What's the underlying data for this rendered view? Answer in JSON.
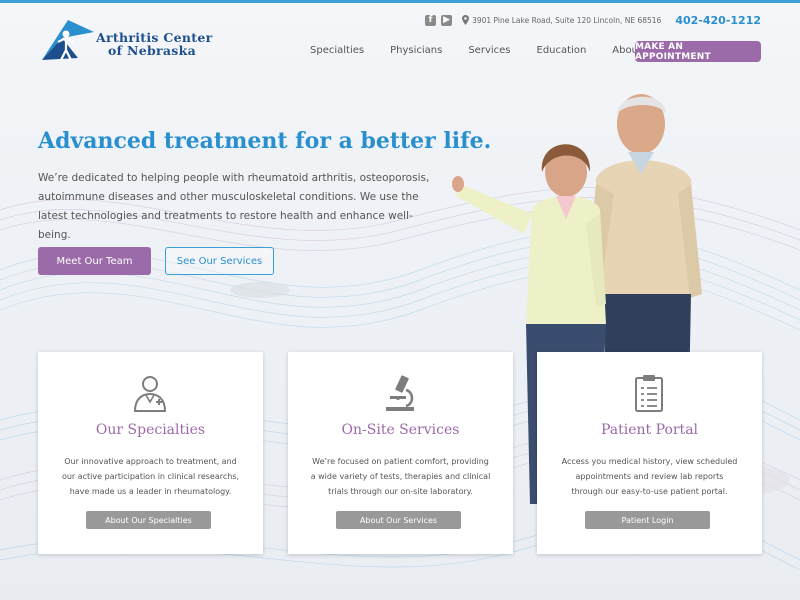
{
  "header": {
    "logo_line1": "Arthritis Center",
    "logo_line2": "of Nebraska",
    "facebook_icon": "facebook-icon",
    "youtube_icon": "youtube-icon",
    "address": "3901 Pine Lake Road, Suite 120 Lincoln, NE 68516",
    "phone": "402-420-1212",
    "nav": [
      "Specialties",
      "Physicians",
      "Services",
      "Education",
      "About"
    ],
    "cta_label": "MAKE AN APPOINTMENT"
  },
  "hero": {
    "headline": "Advanced treatment for a better life.",
    "intro": "We’re dedicated to helping people with rheumatoid arthritis, osteoporosis, autoimmune diseases and other musculoskeletal conditions. We use the latest technologies and treatments to restore health and enhance well-being.",
    "btn_team": "Meet Our Team",
    "btn_services": "See Our Services"
  },
  "cards": [
    {
      "icon": "doctor-icon",
      "title": "Our Specialties",
      "desc": "Our innovative approach to treatment, and our active participation in clinical researchs, have made us a leader in rheumatology.",
      "btn": "About Our Specialties"
    },
    {
      "icon": "microscope-icon",
      "title": "On-Site Services",
      "desc": "We’re focused on patient comfort, providing a wide variety of tests, therapies and clinical trials through our on-site laboratory.",
      "btn": "About Our Services"
    },
    {
      "icon": "clipboard-icon",
      "title": "Patient Portal",
      "desc": "Access you medical history, view scheduled appointments and review lab reports through our easy-to-use patient portal.",
      "btn": "Patient Login"
    }
  ],
  "colors": {
    "brand_blue": "#2a8fcf",
    "brand_navy": "#1d4f8c",
    "brand_purple": "#9b6aa8",
    "button_gray": "#999999"
  }
}
